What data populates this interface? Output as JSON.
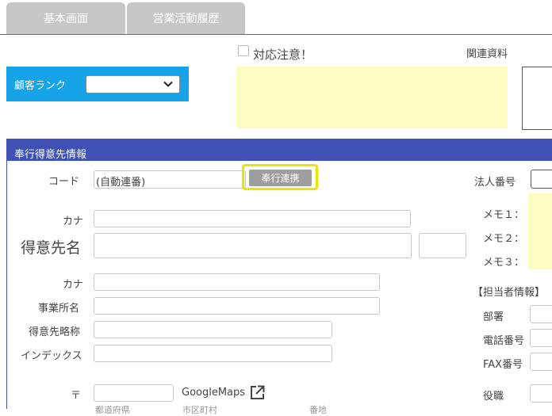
{
  "tabs": [
    {
      "label": "基本画面"
    },
    {
      "label": "営業活動履歴"
    }
  ],
  "rank": {
    "label": "顧客ランク",
    "value": ""
  },
  "attention": {
    "label": "対応注意！",
    "checked": false
  },
  "related_docs": {
    "label": "関連資料"
  },
  "panel": {
    "title": "奉行得意先情報"
  },
  "code": {
    "label": "コード",
    "value": "(自動連番)"
  },
  "link_button": {
    "label": "奉行連携"
  },
  "corp_no": {
    "label": "法人番号"
  },
  "kana1": {
    "label": "カナ"
  },
  "customer_name": {
    "label": "得意先名"
  },
  "kana2": {
    "label": "カナ"
  },
  "office_name": {
    "label": "事業所名"
  },
  "short_name": {
    "label": "得意先略称"
  },
  "index": {
    "label": "インデックス"
  },
  "postal": {
    "label": "〒"
  },
  "googlemaps": {
    "label": "GoogleMaps"
  },
  "bottom_labels": {
    "prefecture": "都道府県",
    "city": "市区町村",
    "number": "番地"
  },
  "memo": {
    "m1": "メモ１：",
    "m2": "メモ２：",
    "m3": "メモ３："
  },
  "contact": {
    "heading": "【担当者情報】",
    "dept": "部署",
    "phone": "電話番号",
    "fax": "FAX番号",
    "title": "役職"
  }
}
